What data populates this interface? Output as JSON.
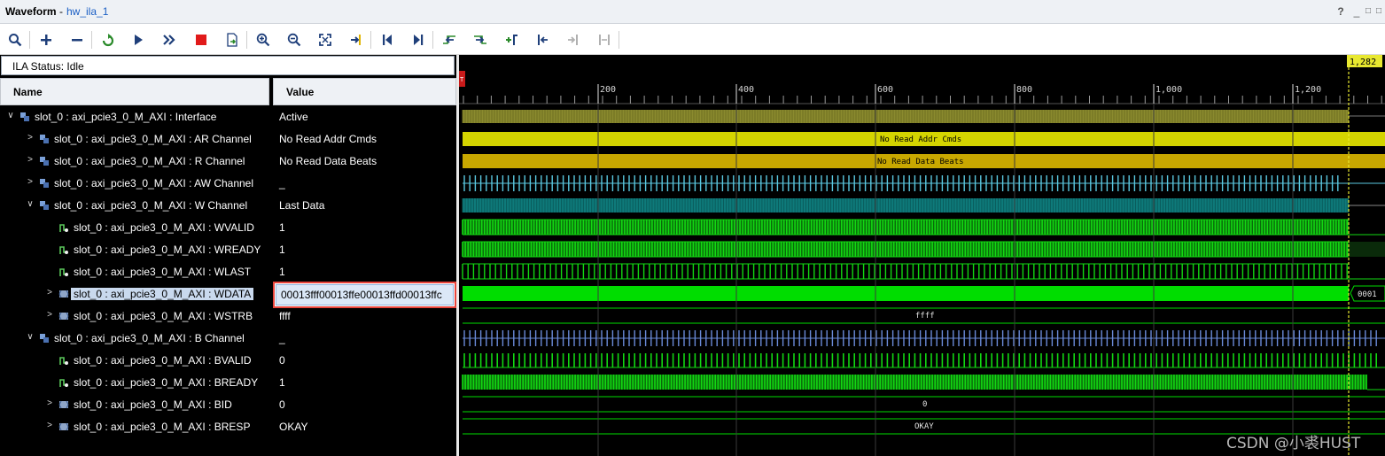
{
  "window": {
    "title": "Waveform",
    "separator": "-",
    "subtitle": "hw_ila_1",
    "help_icon": "?",
    "minimize_icon": "_",
    "restore_icon": "□",
    "maximize_icon": "□"
  },
  "toolbar": {
    "icons": [
      "search-icon",
      "add-icon",
      "remove-icon",
      "refresh-icon",
      "run-icon",
      "run-immediate-icon",
      "stop-icon",
      "export-icon",
      "zoom-in-icon",
      "zoom-out-icon",
      "zoom-fit-icon",
      "goto-cursor-icon",
      "goto-start-icon",
      "goto-end-icon",
      "prev-transition-icon",
      "next-transition-icon",
      "add-marker-icon",
      "prev-marker-icon",
      "next-marker-icon",
      "swap-cursor-icon"
    ]
  },
  "status": {
    "label": "ILA Status:  Idle"
  },
  "columns": {
    "name": "Name",
    "value": "Value"
  },
  "signals": [
    {
      "name": "slot_0 : axi_pcie3_0_M_AXI : Interface",
      "value": "Active",
      "indent": 0,
      "expander": "∨",
      "kind": "interface"
    },
    {
      "name": "slot_0 : axi_pcie3_0_M_AXI : AR Channel",
      "value": "No Read Addr Cmds",
      "indent": 1,
      "expander": ">",
      "kind": "interface"
    },
    {
      "name": "slot_0 : axi_pcie3_0_M_AXI : R Channel",
      "value": "No Read Data Beats",
      "indent": 1,
      "expander": ">",
      "kind": "interface"
    },
    {
      "name": "slot_0 : axi_pcie3_0_M_AXI : AW Channel",
      "value": "_",
      "indent": 1,
      "expander": ">",
      "kind": "interface"
    },
    {
      "name": "slot_0 : axi_pcie3_0_M_AXI : W Channel",
      "value": "Last Data",
      "indent": 1,
      "expander": "∨",
      "kind": "interface"
    },
    {
      "name": "slot_0 : axi_pcie3_0_M_AXI : WVALID",
      "value": "1",
      "indent": 2,
      "expander": "",
      "kind": "bit"
    },
    {
      "name": "slot_0 : axi_pcie3_0_M_AXI : WREADY",
      "value": "1",
      "indent": 2,
      "expander": "",
      "kind": "bit"
    },
    {
      "name": "slot_0 : axi_pcie3_0_M_AXI : WLAST",
      "value": "1",
      "indent": 2,
      "expander": "",
      "kind": "bit"
    },
    {
      "name": "slot_0 : axi_pcie3_0_M_AXI : WDATA",
      "value": "00013fff00013ffe00013ffd00013ffc",
      "indent": 2,
      "expander": ">",
      "kind": "bus",
      "selected": true
    },
    {
      "name": "slot_0 : axi_pcie3_0_M_AXI : WSTRB",
      "value": "ffff",
      "indent": 2,
      "expander": ">",
      "kind": "bus"
    },
    {
      "name": "slot_0 : axi_pcie3_0_M_AXI : B Channel",
      "value": "_",
      "indent": 1,
      "expander": "∨",
      "kind": "interface"
    },
    {
      "name": "slot_0 : axi_pcie3_0_M_AXI : BVALID",
      "value": "0",
      "indent": 2,
      "expander": "",
      "kind": "bit"
    },
    {
      "name": "slot_0 : axi_pcie3_0_M_AXI : BREADY",
      "value": "1",
      "indent": 2,
      "expander": "",
      "kind": "bit"
    },
    {
      "name": "slot_0 : axi_pcie3_0_M_AXI : BID",
      "value": "0",
      "indent": 2,
      "expander": ">",
      "kind": "bus"
    },
    {
      "name": "slot_0 : axi_pcie3_0_M_AXI : BRESP",
      "value": "OKAY",
      "indent": 2,
      "expander": ">",
      "kind": "bus"
    }
  ],
  "waveform": {
    "ruler_ticks": [
      "200",
      "400",
      "600",
      "800",
      "1,000",
      "1,200"
    ],
    "cursor_label": "1,282",
    "trigger_marker": "T",
    "ar_text": "No Read Addr Cmds",
    "r_text": "No Read Data Beats",
    "wdata_tail_text": "0001",
    "wstrb_text": "ffff",
    "bid_text": "0",
    "bresp_text": "OKAY",
    "colors": {
      "interface_olive": "#8a8a2e",
      "ar_yellow": "#d4d400",
      "r_gold": "#c8a800",
      "aw_cyan": "#5ac8e0",
      "w_teal": "#0e7a7a",
      "bit_green": "#12d812",
      "bus_green": "#00dd00",
      "b_blue": "#6a8ad8",
      "cursor": "#e8e830"
    }
  },
  "watermark": "CSDN @小裘HUST"
}
